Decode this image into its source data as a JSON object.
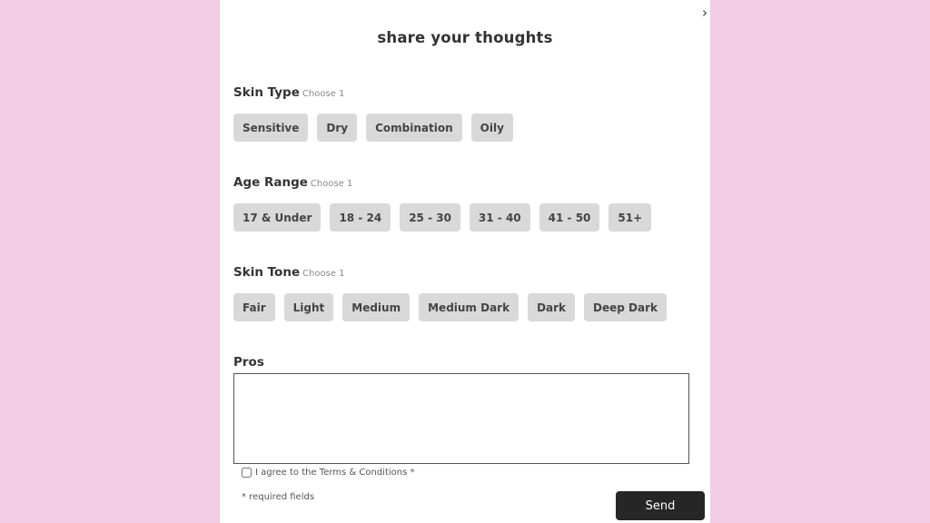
{
  "modal": {
    "title": "share your thoughts",
    "close_icon": "chevron-right-icon"
  },
  "sections": {
    "skin_type": {
      "label": "Skin Type",
      "hint": "Choose 1",
      "options": [
        "Sensitive",
        "Dry",
        "Combination",
        "Oily"
      ]
    },
    "age_range": {
      "label": "Age Range",
      "hint": "Choose 1",
      "options": [
        "17 & Under",
        "18 - 24",
        "25 - 30",
        "31 - 40",
        "41 - 50",
        "51+"
      ]
    },
    "skin_tone": {
      "label": "Skin Tone",
      "hint": "Choose 1",
      "options": [
        "Fair",
        "Light",
        "Medium",
        "Medium Dark",
        "Dark",
        "Deep Dark"
      ]
    }
  },
  "pros": {
    "label": "Pros",
    "value": "",
    "placeholder": ""
  },
  "agree": {
    "label": "I agree to the Terms & Conditions *",
    "checked": false
  },
  "required_note": "* required fields",
  "send_label": "Send",
  "colors": {
    "background": "#f0cde5",
    "chip": "#d9d9d9",
    "send_button": "#262626"
  }
}
